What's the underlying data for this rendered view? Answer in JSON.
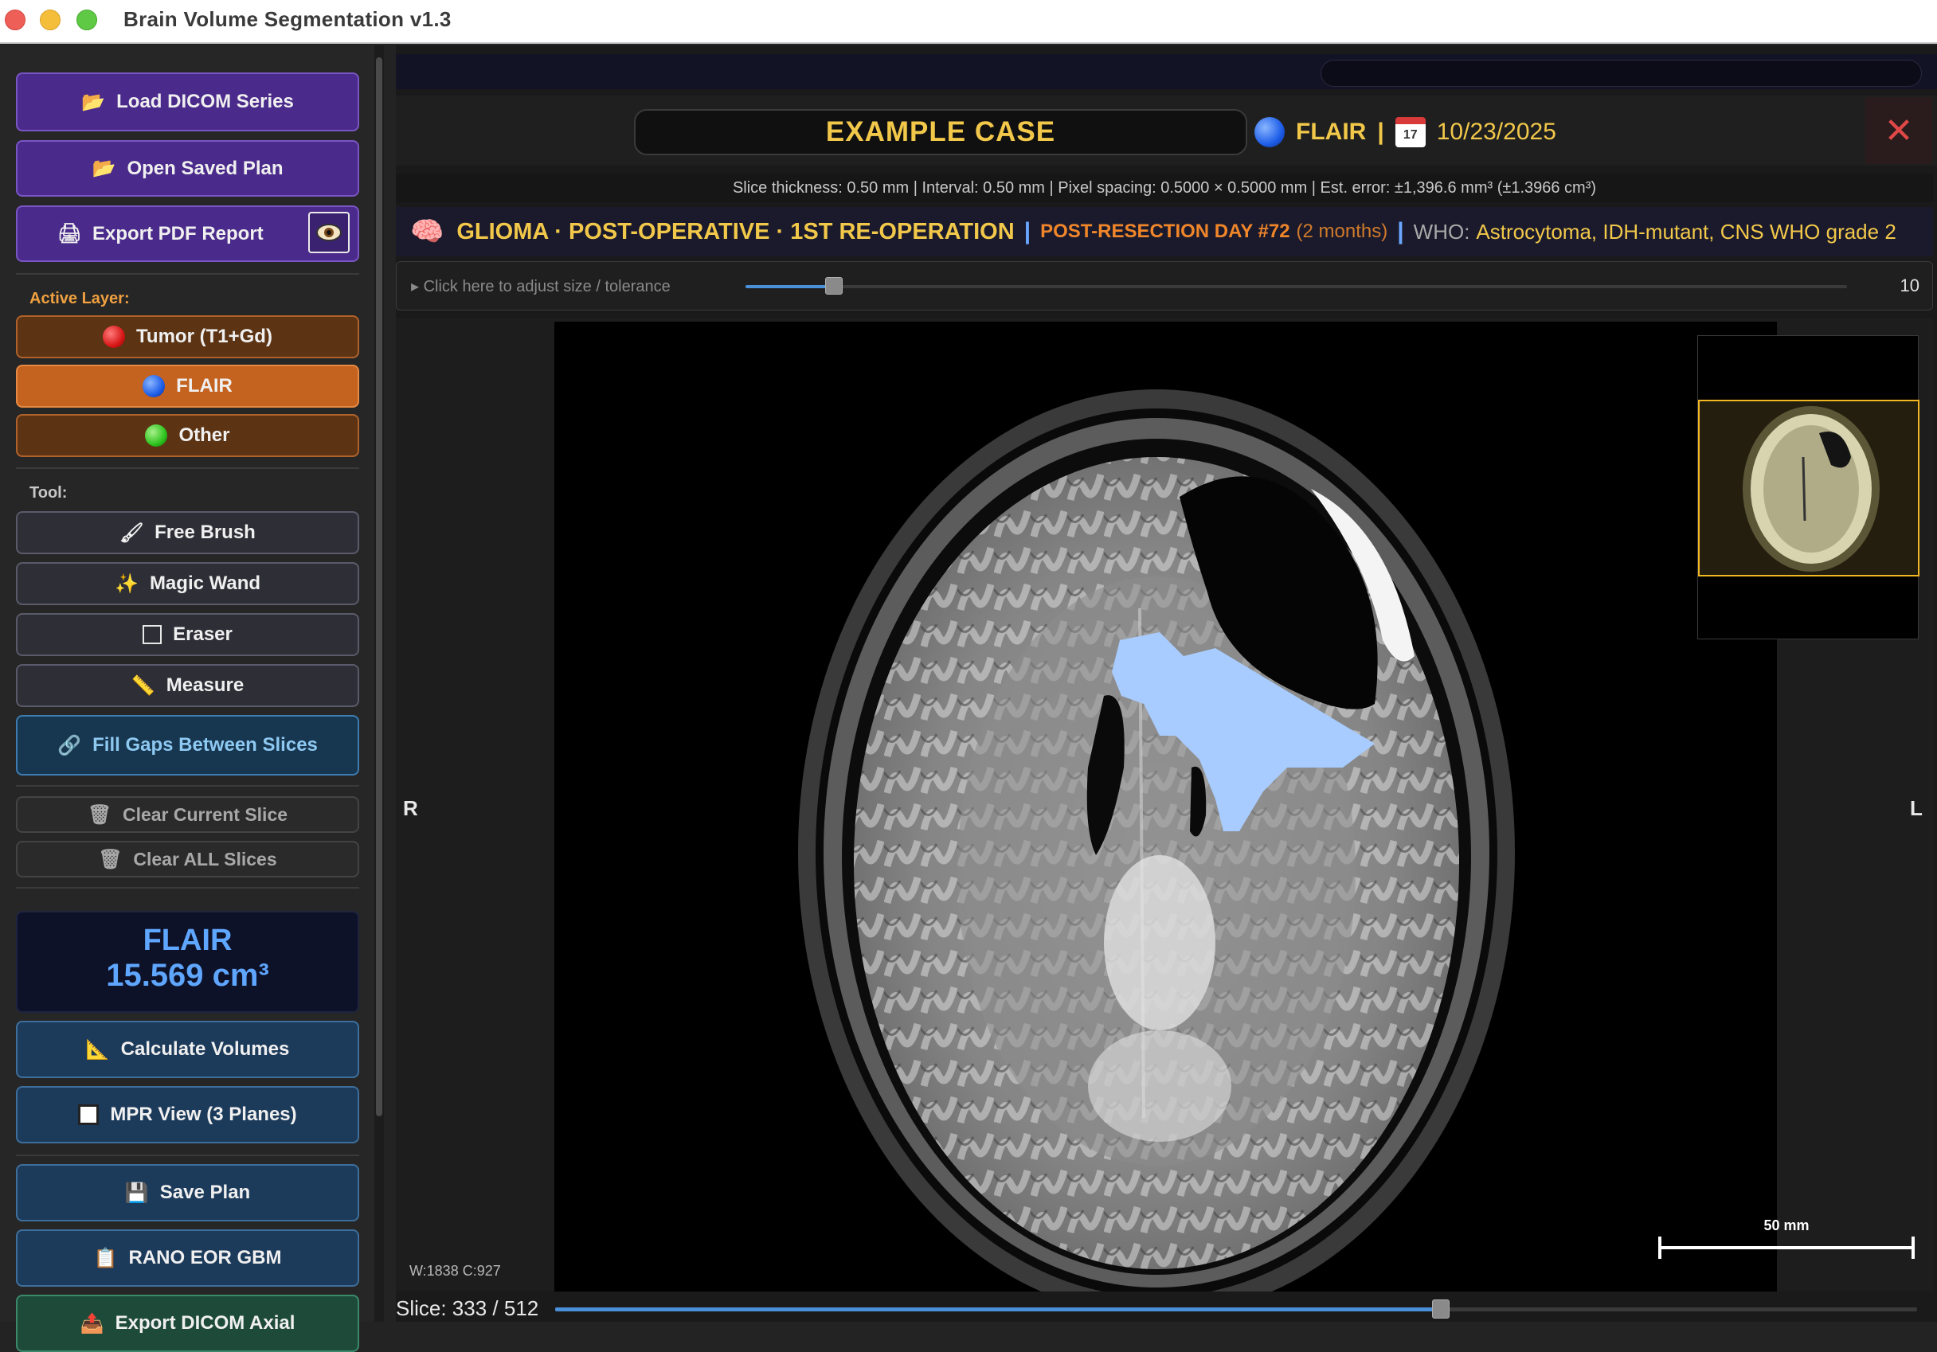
{
  "window": {
    "title": "Brain Volume Segmentation  v1.3"
  },
  "sidebar": {
    "load_dicom": "Load DICOM Series",
    "open_plan": "Open Saved Plan",
    "export_pdf": "Export PDF Report",
    "active_layer_label": "Active Layer:",
    "layers": [
      {
        "label": "Tumor (T1+Gd)",
        "color": "#d81818",
        "active": false
      },
      {
        "label": "FLAIR",
        "color": "#1e5ee8",
        "active": true
      },
      {
        "label": "Other",
        "color": "#2ec41e",
        "active": false
      }
    ],
    "tool_label": "Tool:",
    "tools": {
      "free_brush": "Free Brush",
      "magic_wand": "Magic Wand",
      "eraser": "Eraser",
      "measure": "Measure"
    },
    "fill_gaps": "Fill Gaps Between Slices",
    "clear_current": "Clear Current Slice",
    "clear_all": "Clear ALL Slices",
    "volume": {
      "layer": "FLAIR",
      "value": "15.569 cm³"
    },
    "calc_volumes": "Calculate Volumes",
    "mpr_view": "MPR View  (3 Planes)",
    "save_plan": "Save Plan",
    "rano": "RANO EOR GBM",
    "export_dicom": "Export DICOM Axial"
  },
  "header": {
    "case_name": "EXAMPLE CASE",
    "sequence": "FLAIR",
    "separator": "|",
    "date": "10/23/2025",
    "calendar_day": "17",
    "close": "✕"
  },
  "info": {
    "text": "Slice thickness: 0.50 mm   |   Interval: 0.50 mm   |   Pixel spacing: 0.5000 × 0.5000 mm   |   Est. error: ±1,396.6 mm³  (±1.3966 cm³)"
  },
  "diagnosis": {
    "main": "GLIOMA · POST-OPERATIVE · 1ST RE-OPERATION",
    "separator": "|",
    "day": "POST-RESECTION DAY #72",
    "months": "(2 months)",
    "who_label": "WHO:",
    "who_value": "Astrocytoma, IDH-mutant, CNS WHO grade 2"
  },
  "tolerance": {
    "hint": "▸  Click here to adjust size / tolerance",
    "value": "10",
    "fraction": 0.08
  },
  "viewer": {
    "left_orient": "R",
    "right_orient": "L",
    "window_level": "W:1838  C:927",
    "scale_label": "50 mm"
  },
  "slice": {
    "label": "Slice: 333 / 512",
    "current": 333,
    "total": 512
  },
  "colors": {
    "accent_gold": "#f2c84a",
    "flair_blue": "#a8ccff",
    "slider_blue": "#4a90d8"
  }
}
